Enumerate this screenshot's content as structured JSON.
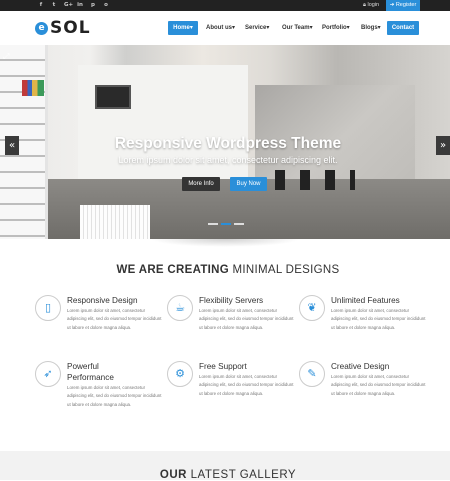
{
  "topbar": {
    "social": [
      "f",
      "t",
      "G+",
      "in",
      "p",
      "o"
    ],
    "social_icons": [
      "facebook-icon",
      "twitter-icon",
      "google-plus-icon",
      "linkedin-icon",
      "pinterest-icon",
      "instagram-icon"
    ],
    "login": "login",
    "register": "Register"
  },
  "brand": {
    "logo_text": "SOL",
    "logo_mark": "e"
  },
  "nav": {
    "items": [
      "Home",
      "About us",
      "Service",
      "Our Team",
      "Portfolio",
      "Blogs"
    ],
    "contact": "Contact"
  },
  "hero": {
    "title": "Responsive Wordpress Theme",
    "subtitle": "Lorem ipsum dolor sit amet, consectetur adipiscing elit.",
    "more_button": "More Info",
    "buy_button": "Buy Now",
    "prev_glyph": "«",
    "next_glyph": "»",
    "slide_count": 3,
    "active_slide": 1
  },
  "section": {
    "title_bold": "WE ARE CREATING",
    "title_rest": " MINIMAL DESIGNS"
  },
  "features": [
    {
      "icon": "tablet-icon",
      "glyph": "▯",
      "title": "Responsive Design",
      "text": "Lorem ipsum dolor sit amet, consectetur adipiscing elit, sed do eiusmod tempor incididunt ut labore et dolore magna aliqua."
    },
    {
      "icon": "server-icon",
      "glyph": "☕",
      "title": "Flexibility Servers",
      "text": "Lorem ipsum dolor sit amet, consectetur adipiscing elit, sed do eiusmod tempor incididunt ut labore et dolore magna aliqua."
    },
    {
      "icon": "leaf-icon",
      "glyph": "❦",
      "title": "Unlimited Features",
      "text": "Lorem ipsum dolor sit amet, consectetur adipiscing elit, sed do eiusmod tempor incididunt ut labore et dolore magna aliqua."
    },
    {
      "icon": "rocket-icon",
      "glyph": "➶",
      "title": "Powerful Performance",
      "text": "Lorem ipsum dolor sit amet, consectetur adipiscing elit, sed do eiusmod tempor incididunt ut labore et dolore magna aliqua."
    },
    {
      "icon": "cogs-icon",
      "glyph": "⚙",
      "title": "Free Support",
      "text": "Lorem ipsum dolor sit amet, consectetur adipiscing elit, sed do eiusmod tempor incididunt ut labore et dolore magna aliqua."
    },
    {
      "icon": "magic-wand-icon",
      "glyph": "✎",
      "title": "Creative Design",
      "text": "Lorem ipsum dolor sit amet, consectetur adipiscing elit, sed do eiusmod tempor incididunt ut labore et dolore magna aliqua."
    }
  ],
  "gallery": {
    "title_bold": "OUR",
    "title_rest": " LATEST GALLERY"
  },
  "colors": {
    "accent": "#2a8fd9",
    "topbar": "#222222",
    "dark_button": "#343434"
  }
}
